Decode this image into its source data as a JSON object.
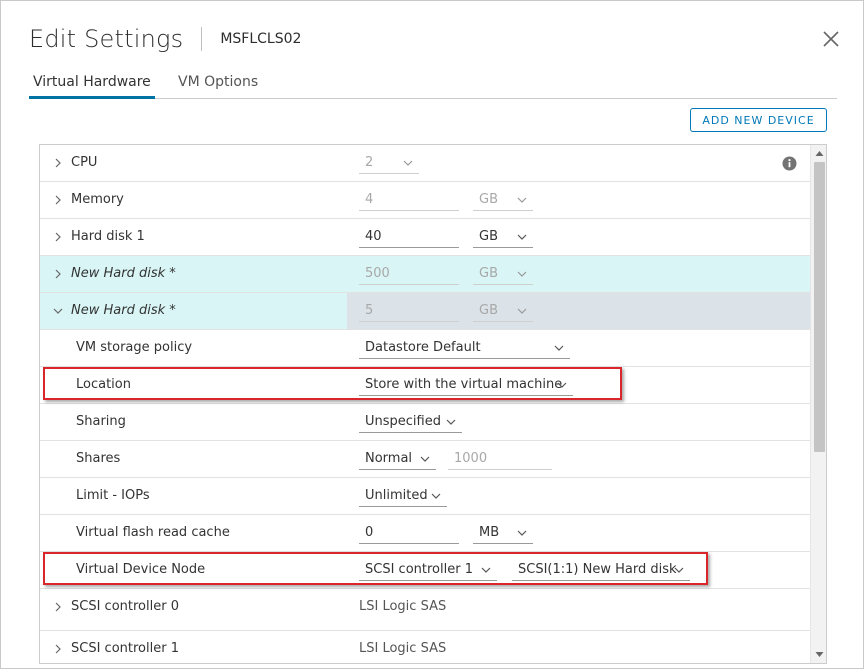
{
  "dialog": {
    "title": "Edit Settings",
    "vm_name": "MSFLCLS02"
  },
  "tabs": [
    {
      "label": "Virtual Hardware",
      "active": true
    },
    {
      "label": "VM Options",
      "active": false
    }
  ],
  "toolbar": {
    "add_device_label": "ADD NEW DEVICE"
  },
  "hardware": {
    "cpu": {
      "label": "CPU",
      "value": "2"
    },
    "memory": {
      "label": "Memory",
      "value": "4",
      "unit": "GB"
    },
    "hard_disk_1": {
      "label": "Hard disk 1",
      "value": "40",
      "unit": "GB"
    },
    "new_disk_a": {
      "label": "New Hard disk *",
      "value": "500",
      "unit": "GB"
    },
    "new_disk_b": {
      "label": "New Hard disk *",
      "value": "5",
      "unit": "GB",
      "storage_policy": {
        "label": "VM storage policy",
        "value": "Datastore Default"
      },
      "location": {
        "label": "Location",
        "value": "Store with the virtual machine"
      },
      "sharing": {
        "label": "Sharing",
        "value": "Unspecified"
      },
      "shares": {
        "label": "Shares",
        "level": "Normal",
        "value": "1000"
      },
      "limit_iops": {
        "label": "Limit - IOPs",
        "value": "Unlimited"
      },
      "flash_cache": {
        "label": "Virtual flash read cache",
        "value": "0",
        "unit": "MB"
      },
      "device_node": {
        "label": "Virtual Device Node",
        "controller": "SCSI controller 1",
        "node": "SCSI(1:1) New Hard disk"
      }
    },
    "scsi_0": {
      "label": "SCSI controller 0",
      "value": "LSI Logic SAS"
    },
    "scsi_1": {
      "label": "SCSI controller 1",
      "value": "LSI Logic SAS"
    }
  },
  "colors": {
    "accent": "#0079b8",
    "highlight_cyan": "#d9f5f5",
    "selected_row": "#dbe3e8",
    "annotation_red": "#d9262b"
  }
}
